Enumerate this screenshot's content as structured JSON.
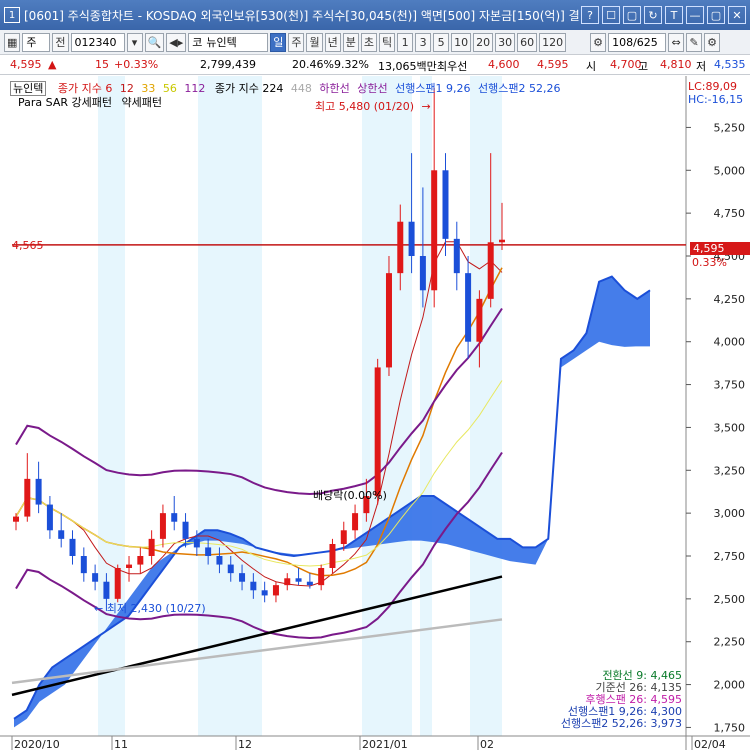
{
  "window": {
    "app_number": "1",
    "title": "[0601] 주식종합차트 - KOSDAQ 외국인보유[530(천)] 주식수[30,045(천)] 액면[500] 자본금[150(억)] 결",
    "buttons": [
      "?",
      "☐",
      "▢",
      "↻",
      "T",
      "—",
      "▢",
      "✕"
    ]
  },
  "toolbar": {
    "type_select": "주",
    "mode_label": "전",
    "code_value": "012340",
    "name_prefix": "코",
    "name_value": "뉴인텍",
    "period_buttons": [
      "일",
      "주",
      "월",
      "년",
      "분",
      "초",
      "틱"
    ],
    "active_period": "일",
    "minute_buttons": [
      "1",
      "3",
      "5",
      "10",
      "20",
      "30",
      "60",
      "120"
    ],
    "page_counter": "108/625"
  },
  "quote": {
    "price": "4,595",
    "change": "15",
    "change_pct": "+0.33%",
    "volume": "2,799,439",
    "turnover_pct": "20.46%",
    "vol_ratio": "9.32%",
    "amount": "13,065백만",
    "label_best": "최우선",
    "best_value": "4,600",
    "best_value2": "4,595",
    "label_high": "시",
    "open": "4,700",
    "label_h": "고",
    "high": "4,810",
    "label_l": "저",
    "low": "4,535"
  },
  "legend": {
    "item_name": "뉴인텍",
    "ma_label": "종가 지수",
    "ma1": "6",
    "ma2": "12",
    "ma3": "33",
    "ma4": "56",
    "ma5": "112",
    "ma6_label": "종가 지수 224",
    "ma7": "448",
    "lower_limit": "하한선",
    "upper_limit": "상한선",
    "span1_label": "선행스팬1 9,26",
    "span2_label": "선행스팬2 52,26",
    "parasar": "Para SAR 강세패턴",
    "weak": "약세패턴",
    "lc": "LC:89,09",
    "hc": "HC:-16,15"
  },
  "annotations": {
    "high_note": "최고 5,480 (01/20)",
    "low_note": "최저 2,430 (10/27)",
    "dividend": "배당락(0.00%)",
    "ref_line_value": "4,565",
    "current_price_tag": "4,595",
    "current_pct_tag": "0.33%"
  },
  "ichimoku_values": [
    {
      "label": "전환선 9: 4,465",
      "color": "#0a7a2a"
    },
    {
      "label": "기준선 26: 4,135",
      "color": "#444444"
    },
    {
      "label": "후행스팬 26: 4,595",
      "color": "#c01ca8"
    },
    {
      "label": "선행스팬1 9,26: 4,300",
      "color": "#1b3fb0"
    },
    {
      "label": "선행스팬2 52,26: 3,973",
      "color": "#1b3fb0"
    }
  ],
  "chart_data": {
    "type": "candlestick",
    "x_labels": [
      "2020/10",
      "11",
      "12",
      "2021/01",
      "02",
      "02/04"
    ],
    "y_ticks": [
      "5,250",
      "5,000",
      "4,750",
      "4,500",
      "4,250",
      "4,000",
      "3,750",
      "3,500",
      "3,250",
      "3,000",
      "2,750",
      "2,500",
      "2,250",
      "2,000",
      "1,750"
    ],
    "ylim": [
      1700,
      5550
    ],
    "ref_line": 4565,
    "current": 4595,
    "candles": [
      [
        2950,
        3000,
        2900,
        2980
      ],
      [
        2980,
        3350,
        2950,
        3200
      ],
      [
        3200,
        3300,
        3000,
        3050
      ],
      [
        3050,
        3100,
        2850,
        2900
      ],
      [
        2900,
        3000,
        2800,
        2850
      ],
      [
        2850,
        2900,
        2700,
        2750
      ],
      [
        2750,
        2800,
        2600,
        2650
      ],
      [
        2650,
        2700,
        2550,
        2600
      ],
      [
        2600,
        2650,
        2430,
        2500
      ],
      [
        2500,
        2700,
        2480,
        2680
      ],
      [
        2680,
        2750,
        2600,
        2700
      ],
      [
        2700,
        2800,
        2650,
        2750
      ],
      [
        2750,
        2900,
        2700,
        2850
      ],
      [
        2850,
        3050,
        2800,
        3000
      ],
      [
        3000,
        3100,
        2900,
        2950
      ],
      [
        2950,
        3000,
        2800,
        2850
      ],
      [
        2850,
        2900,
        2750,
        2800
      ],
      [
        2800,
        2850,
        2700,
        2750
      ],
      [
        2750,
        2800,
        2650,
        2700
      ],
      [
        2700,
        2750,
        2600,
        2650
      ],
      [
        2650,
        2700,
        2550,
        2600
      ],
      [
        2600,
        2650,
        2500,
        2550
      ],
      [
        2550,
        2600,
        2480,
        2520
      ],
      [
        2520,
        2600,
        2480,
        2580
      ],
      [
        2580,
        2650,
        2550,
        2620
      ],
      [
        2620,
        2680,
        2580,
        2600
      ],
      [
        2600,
        2650,
        2560,
        2580
      ],
      [
        2580,
        2700,
        2550,
        2680
      ],
      [
        2680,
        2850,
        2650,
        2820
      ],
      [
        2820,
        2950,
        2780,
        2900
      ],
      [
        2900,
        3050,
        2850,
        3000
      ],
      [
        3000,
        3200,
        2950,
        3100
      ],
      [
        3100,
        3900,
        3050,
        3850
      ],
      [
        3850,
        4500,
        3800,
        4400
      ],
      [
        4400,
        4800,
        4300,
        4700
      ],
      [
        4700,
        5100,
        4400,
        4500
      ],
      [
        4500,
        4900,
        4200,
        4300
      ],
      [
        4300,
        5480,
        4200,
        5000
      ],
      [
        5000,
        5100,
        4500,
        4600
      ],
      [
        4600,
        4700,
        4300,
        4400
      ],
      [
        4400,
        4500,
        3900,
        4000
      ],
      [
        4000,
        4300,
        3850,
        4250
      ],
      [
        4250,
        5100,
        4200,
        4580
      ],
      [
        4580,
        4810,
        4535,
        4595
      ]
    ],
    "ichimoku_span1": [
      1800,
      1850,
      2000,
      2100,
      2150,
      2200,
      2250,
      2300,
      2350,
      2400,
      2500,
      2600,
      2700,
      2800,
      2850,
      2900,
      2900,
      2880,
      2850,
      2800,
      2780,
      2760,
      2750,
      2760,
      2770,
      2780,
      2800,
      2850,
      2900,
      2950,
      3000,
      3050,
      3100,
      3100,
      3050,
      3000,
      2950,
      2900,
      2850,
      2850,
      2800,
      2800,
      2850,
      3900,
      3950,
      4050,
      4350,
      4380,
      4300,
      4250,
      4300
    ],
    "ichimoku_span2": [
      1750,
      1800,
      1900,
      1950,
      2000,
      2100,
      2200,
      2300,
      2400,
      2500,
      2600,
      2700,
      2750,
      2800,
      2820,
      2840,
      2840,
      2830,
      2820,
      2800,
      2780,
      2770,
      2760,
      2760,
      2770,
      2780,
      2790,
      2800,
      2810,
      2820,
      2830,
      2840,
      2840,
      2830,
      2820,
      2800,
      2780,
      2760,
      2740,
      2720,
      2710,
      2700,
      2850,
      3850,
      3900,
      3950,
      4000,
      3980,
      3970,
      3973,
      3973
    ]
  }
}
